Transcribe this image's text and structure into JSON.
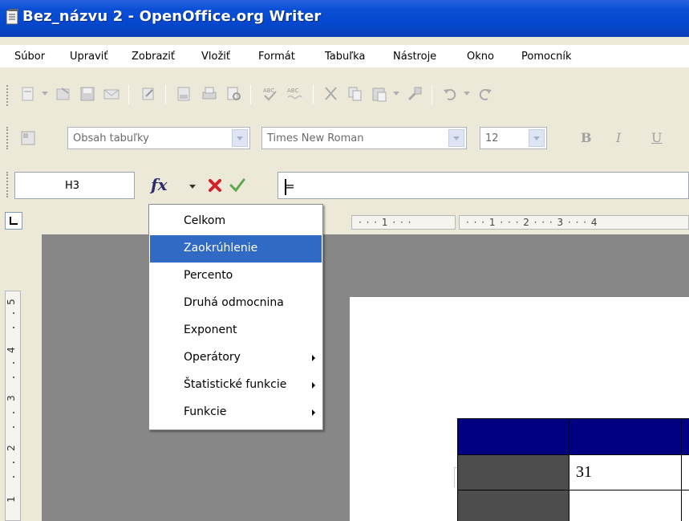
{
  "window": {
    "title": "Bez_názvu 2 - OpenOffice.org Writer",
    "app_icon": "writer-app-icon"
  },
  "menubar": {
    "items": [
      {
        "label": "Súbor"
      },
      {
        "label": "Upraviť"
      },
      {
        "label": "Zobraziť"
      },
      {
        "label": "Vložiť"
      },
      {
        "label": "Formát"
      },
      {
        "label": "Tabuľka"
      },
      {
        "label": "Nástroje"
      },
      {
        "label": "Okno"
      },
      {
        "label": "Pomocník"
      }
    ]
  },
  "standard_toolbar": {
    "icons": [
      "new-document-icon",
      "open-icon",
      "save-icon",
      "email-icon",
      "edit-file-icon",
      "export-pdf-icon",
      "print-icon",
      "page-preview-icon",
      "spellcheck-icon",
      "autospellcheck-icon",
      "cut-icon",
      "copy-icon",
      "paste-icon",
      "clone-formatting-icon",
      "undo-icon",
      "redo-icon"
    ]
  },
  "formatting_toolbar": {
    "style": "Obsah tabuľky",
    "font": "Times New Roman",
    "size": "12",
    "bold": "B",
    "italic": "I",
    "underline": "U"
  },
  "formula_bar": {
    "cell_ref": "H3",
    "formula": "="
  },
  "ruler": {
    "h_left": "· · · 1 · · ·",
    "h_right": "· · · 1 · · · 2 · · · 3 · · · 4",
    "v_numbers": [
      "5",
      "4",
      "3",
      "2",
      "1"
    ]
  },
  "formula_menu": {
    "items": [
      {
        "label": "Celkom",
        "submenu": false,
        "selected": false
      },
      {
        "label": "Zaokrúhlenie",
        "submenu": false,
        "selected": true
      },
      {
        "label": "Percento",
        "submenu": false,
        "selected": false
      },
      {
        "label": "Druhá odmocnina",
        "submenu": false,
        "selected": false
      },
      {
        "label": "Exponent",
        "submenu": false,
        "selected": false
      },
      {
        "label": "Operátory",
        "submenu": true,
        "selected": false
      },
      {
        "label": "Štatistické funkcie",
        "submenu": true,
        "selected": false
      },
      {
        "label": "Funkcie",
        "submenu": true,
        "selected": false
      }
    ]
  },
  "document_table": {
    "header_color": "#000080",
    "label_col_color": "#4d4d4d",
    "cell_value": "31"
  },
  "colors": {
    "titlebar": "#0a4fd6",
    "selection": "#316ac5",
    "workspace": "#878787"
  }
}
